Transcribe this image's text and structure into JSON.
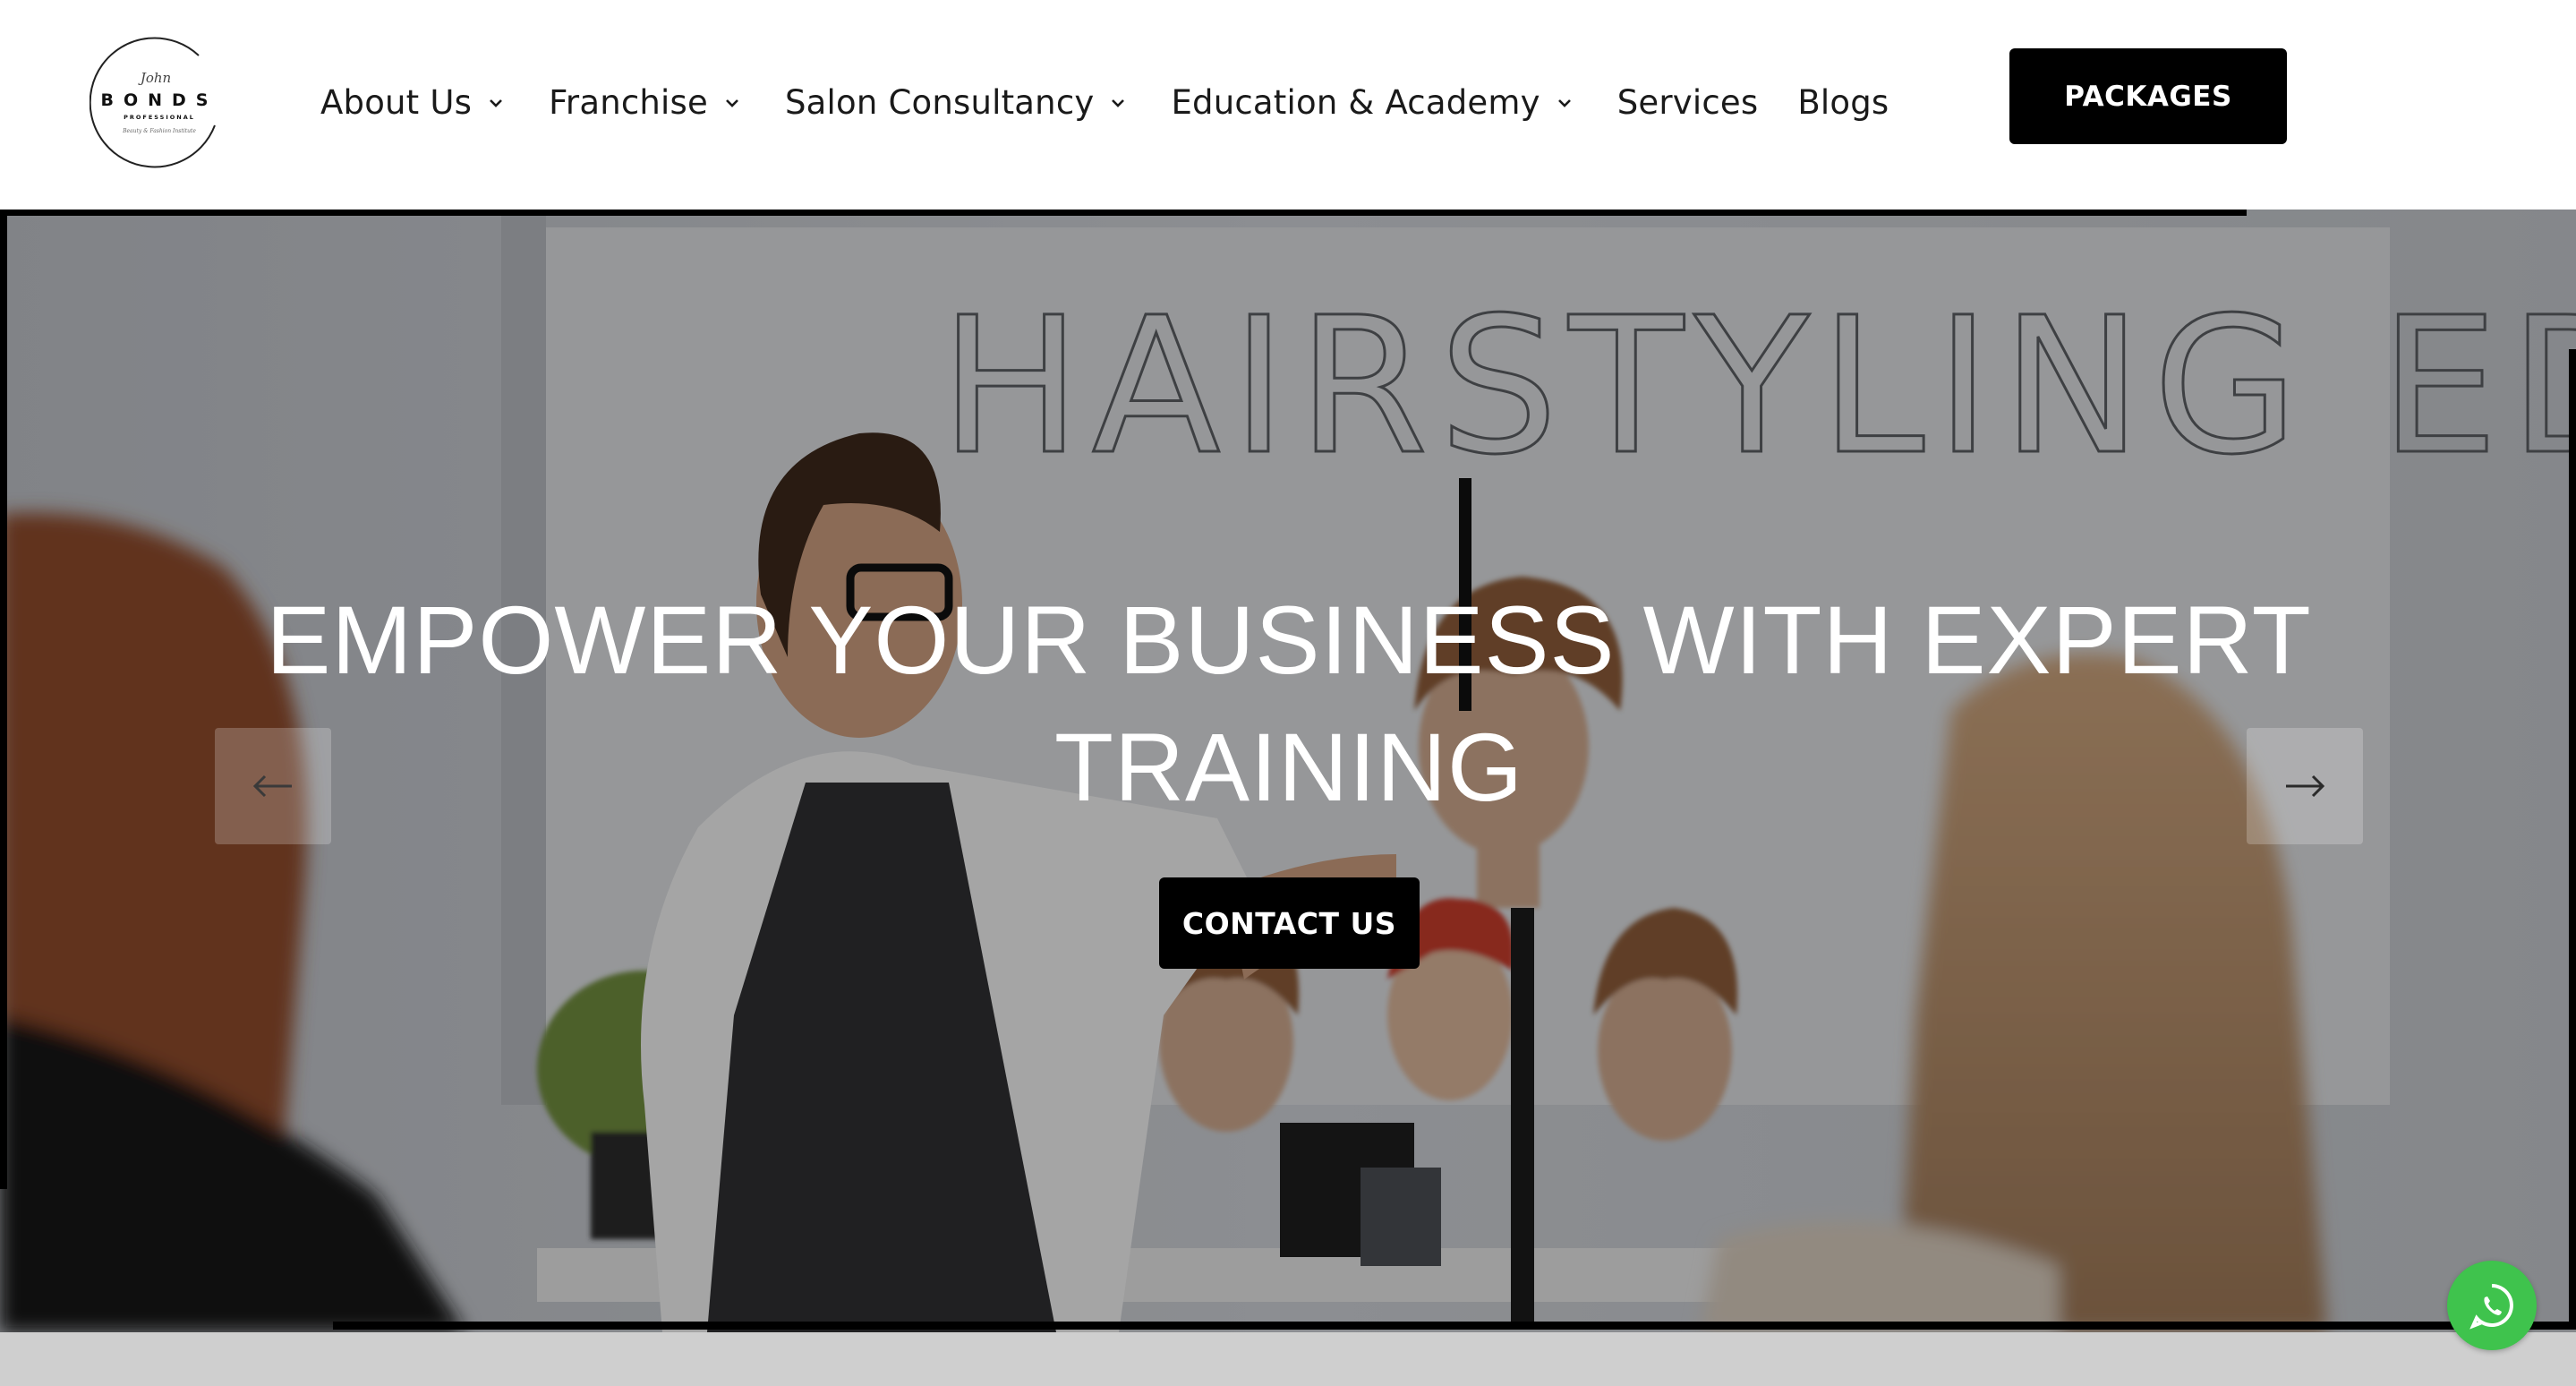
{
  "header": {
    "logo": {
      "brand": "BONDS",
      "subtitle": "PROFESSIONAL",
      "signature": "John",
      "tagline": "Beauty & Fashion Institute"
    },
    "nav": [
      {
        "label": "About Us",
        "has_dropdown": true
      },
      {
        "label": "Franchise",
        "has_dropdown": true
      },
      {
        "label": "Salon Consultancy",
        "has_dropdown": true
      },
      {
        "label": "Education & Academy",
        "has_dropdown": true
      },
      {
        "label": "Services",
        "has_dropdown": false
      },
      {
        "label": "Blogs",
        "has_dropdown": false
      }
    ],
    "packages_label": "PACKAGES"
  },
  "hero": {
    "title_line1": "EMPOWER YOUR BUSINESS WITH EXPERT",
    "title_line2": "TRAINING",
    "cta_label": "CONTACT US",
    "board_text": "HAIRSTYLING EDUCATION"
  },
  "icons": {
    "nav_dropdown": "chevron-down-icon",
    "slider_prev": "arrow-left-icon",
    "slider_next": "arrow-right-icon",
    "chat": "whatsapp-icon"
  },
  "colors": {
    "primary_button": "#000000",
    "button_text": "#ffffff",
    "nav_text": "#1a1a1a",
    "whatsapp": "#3fc34d"
  }
}
